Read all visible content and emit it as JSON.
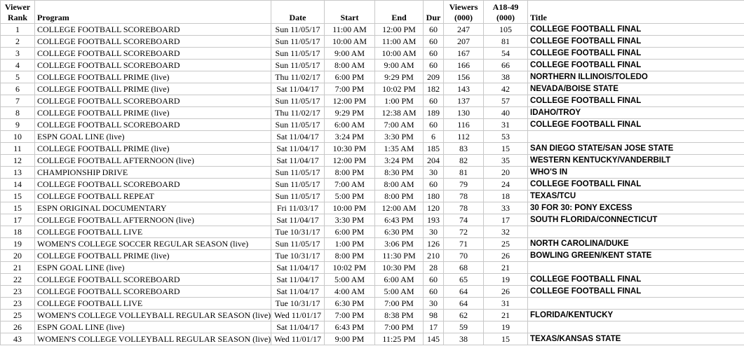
{
  "columns": {
    "rank": [
      "Viewer",
      "Rank"
    ],
    "program": "Program",
    "date": "Date",
    "start": "Start",
    "end": "End",
    "dur": "Dur",
    "viewers": [
      "Viewers",
      "(000)"
    ],
    "a1849": [
      "A18-49",
      "(000)"
    ],
    "title": "Title"
  },
  "rows": [
    {
      "rank": "1",
      "program": "COLLEGE FOOTBALL SCOREBOARD",
      "date": "Sun 11/05/17",
      "start": "11:00 AM",
      "end": "12:00 PM",
      "dur": "60",
      "viewers": "247",
      "a1849": "105",
      "title": "COLLEGE FOOTBALL FINAL"
    },
    {
      "rank": "2",
      "program": "COLLEGE FOOTBALL SCOREBOARD",
      "date": "Sun 11/05/17",
      "start": "10:00 AM",
      "end": "11:00 AM",
      "dur": "60",
      "viewers": "207",
      "a1849": "81",
      "title": "COLLEGE FOOTBALL FINAL"
    },
    {
      "rank": "3",
      "program": "COLLEGE FOOTBALL SCOREBOARD",
      "date": "Sun 11/05/17",
      "start": "9:00 AM",
      "end": "10:00 AM",
      "dur": "60",
      "viewers": "167",
      "a1849": "54",
      "title": "COLLEGE FOOTBALL FINAL"
    },
    {
      "rank": "4",
      "program": "COLLEGE FOOTBALL SCOREBOARD",
      "date": "Sun 11/05/17",
      "start": "8:00 AM",
      "end": "9:00 AM",
      "dur": "60",
      "viewers": "166",
      "a1849": "66",
      "title": "COLLEGE FOOTBALL FINAL"
    },
    {
      "rank": "5",
      "program": "COLLEGE FOOTBALL PRIME (live)",
      "date": "Thu 11/02/17",
      "start": "6:00 PM",
      "end": "9:29 PM",
      "dur": "209",
      "viewers": "156",
      "a1849": "38",
      "title": "NORTHERN ILLINOIS/TOLEDO"
    },
    {
      "rank": "6",
      "program": "COLLEGE FOOTBALL PRIME (live)",
      "date": "Sat 11/04/17",
      "start": "7:00 PM",
      "end": "10:02 PM",
      "dur": "182",
      "viewers": "143",
      "a1849": "42",
      "title": "NEVADA/BOISE STATE"
    },
    {
      "rank": "7",
      "program": "COLLEGE FOOTBALL SCOREBOARD",
      "date": "Sun 11/05/17",
      "start": "12:00 PM",
      "end": "1:00 PM",
      "dur": "60",
      "viewers": "137",
      "a1849": "57",
      "title": "COLLEGE FOOTBALL FINAL"
    },
    {
      "rank": "8",
      "program": "COLLEGE FOOTBALL PRIME (live)",
      "date": "Thu 11/02/17",
      "start": "9:29 PM",
      "end": "12:38 AM",
      "dur": "189",
      "viewers": "130",
      "a1849": "40",
      "title": "IDAHO/TROY"
    },
    {
      "rank": "9",
      "program": "COLLEGE FOOTBALL SCOREBOARD",
      "date": "Sun 11/05/17",
      "start": "6:00 AM",
      "end": "7:00 AM",
      "dur": "60",
      "viewers": "116",
      "a1849": "31",
      "title": "COLLEGE FOOTBALL FINAL"
    },
    {
      "rank": "10",
      "program": "ESPN GOAL LINE (live)",
      "date": "Sat 11/04/17",
      "start": "3:24 PM",
      "end": "3:30 PM",
      "dur": "6",
      "viewers": "112",
      "a1849": "53",
      "title": ""
    },
    {
      "rank": "11",
      "program": "COLLEGE FOOTBALL PRIME (live)",
      "date": "Sat 11/04/17",
      "start": "10:30 PM",
      "end": "1:35 AM",
      "dur": "185",
      "viewers": "83",
      "a1849": "15",
      "title": "SAN DIEGO STATE/SAN JOSE STATE"
    },
    {
      "rank": "12",
      "program": "COLLEGE FOOTBALL AFTERNOON (live)",
      "date": "Sat 11/04/17",
      "start": "12:00 PM",
      "end": "3:24 PM",
      "dur": "204",
      "viewers": "82",
      "a1849": "35",
      "title": "WESTERN KENTUCKY/VANDERBILT"
    },
    {
      "rank": "13",
      "program": "CHAMPIONSHIP DRIVE",
      "date": "Sun 11/05/17",
      "start": "8:00 PM",
      "end": "8:30 PM",
      "dur": "30",
      "viewers": "81",
      "a1849": "20",
      "title": "WHO'S IN"
    },
    {
      "rank": "14",
      "program": "COLLEGE FOOTBALL SCOREBOARD",
      "date": "Sun 11/05/17",
      "start": "7:00 AM",
      "end": "8:00 AM",
      "dur": "60",
      "viewers": "79",
      "a1849": "24",
      "title": "COLLEGE FOOTBALL FINAL"
    },
    {
      "rank": "15",
      "program": "COLLEGE FOOTBALL REPEAT",
      "date": "Sun 11/05/17",
      "start": "5:00 PM",
      "end": "8:00 PM",
      "dur": "180",
      "viewers": "78",
      "a1849": "18",
      "title": "TEXAS/TCU"
    },
    {
      "rank": "15",
      "program": "ESPN ORIGINAL DOCUMENTARY",
      "date": "Fri 11/03/17",
      "start": "10:00 PM",
      "end": "12:00 AM",
      "dur": "120",
      "viewers": "78",
      "a1849": "33",
      "title": "30 FOR 30: PONY EXCESS"
    },
    {
      "rank": "17",
      "program": "COLLEGE FOOTBALL AFTERNOON (live)",
      "date": "Sat 11/04/17",
      "start": "3:30 PM",
      "end": "6:43 PM",
      "dur": "193",
      "viewers": "74",
      "a1849": "17",
      "title": "SOUTH FLORIDA/CONNECTICUT"
    },
    {
      "rank": "18",
      "program": "COLLEGE FOOTBALL LIVE",
      "date": "Tue 10/31/17",
      "start": "6:00 PM",
      "end": "6:30 PM",
      "dur": "30",
      "viewers": "72",
      "a1849": "32",
      "title": ""
    },
    {
      "rank": "19",
      "program": "WOMEN'S COLLEGE SOCCER REGULAR SEASON (live)",
      "date": "Sun 11/05/17",
      "start": "1:00 PM",
      "end": "3:06 PM",
      "dur": "126",
      "viewers": "71",
      "a1849": "25",
      "title": "NORTH CAROLINA/DUKE"
    },
    {
      "rank": "20",
      "program": "COLLEGE FOOTBALL PRIME (live)",
      "date": "Tue 10/31/17",
      "start": "8:00 PM",
      "end": "11:30 PM",
      "dur": "210",
      "viewers": "70",
      "a1849": "26",
      "title": "BOWLING GREEN/KENT STATE"
    },
    {
      "rank": "21",
      "program": "ESPN GOAL LINE (live)",
      "date": "Sat 11/04/17",
      "start": "10:02 PM",
      "end": "10:30 PM",
      "dur": "28",
      "viewers": "68",
      "a1849": "21",
      "title": ""
    },
    {
      "rank": "22",
      "program": "COLLEGE FOOTBALL SCOREBOARD",
      "date": "Sat 11/04/17",
      "start": "5:00 AM",
      "end": "6:00 AM",
      "dur": "60",
      "viewers": "65",
      "a1849": "19",
      "title": "COLLEGE FOOTBALL FINAL"
    },
    {
      "rank": "23",
      "program": "COLLEGE FOOTBALL SCOREBOARD",
      "date": "Sat 11/04/17",
      "start": "4:00 AM",
      "end": "5:00 AM",
      "dur": "60",
      "viewers": "64",
      "a1849": "26",
      "title": "COLLEGE FOOTBALL FINAL"
    },
    {
      "rank": "23",
      "program": "COLLEGE FOOTBALL LIVE",
      "date": "Tue 10/31/17",
      "start": "6:30 PM",
      "end": "7:00 PM",
      "dur": "30",
      "viewers": "64",
      "a1849": "31",
      "title": ""
    },
    {
      "rank": "25",
      "program": "WOMEN'S COLLEGE VOLLEYBALL REGULAR SEASON (live)",
      "date": "Wed 11/01/17",
      "start": "7:00 PM",
      "end": "8:38 PM",
      "dur": "98",
      "viewers": "62",
      "a1849": "21",
      "title": "FLORIDA/KENTUCKY"
    },
    {
      "rank": "26",
      "program": "ESPN GOAL LINE (live)",
      "date": "Sat 11/04/17",
      "start": "6:43 PM",
      "end": "7:00 PM",
      "dur": "17",
      "viewers": "59",
      "a1849": "19",
      "title": ""
    },
    {
      "rank": "43",
      "program": "WOMEN'S COLLEGE VOLLEYBALL REGULAR SEASON (live)",
      "date": "Wed 11/01/17",
      "start": "9:00 PM",
      "end": "11:25 PM",
      "dur": "145",
      "viewers": "38",
      "a1849": "15",
      "title": "TEXAS/KANSAS STATE"
    }
  ]
}
